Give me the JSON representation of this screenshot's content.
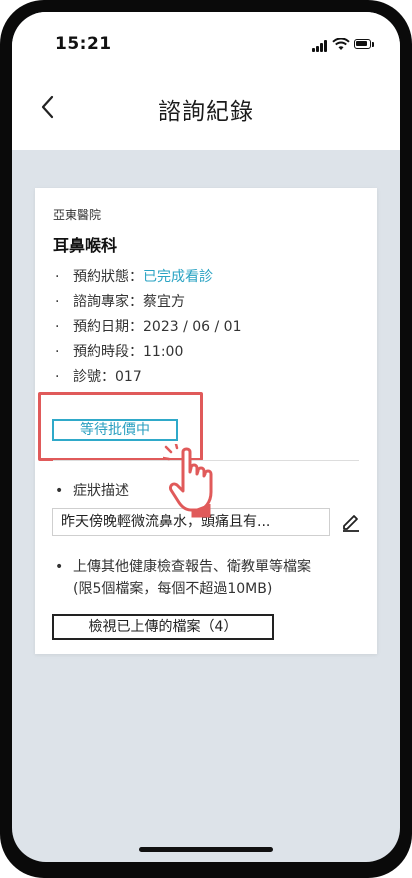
{
  "status_bar": {
    "time": "15:21"
  },
  "header": {
    "title": "諮詢紀錄"
  },
  "record": {
    "hospital": "亞東醫院",
    "department": "耳鼻喉科",
    "info": [
      {
        "label": "預約狀態：",
        "value": "已完成看診",
        "highlight": true
      },
      {
        "label": "諮詢專家：",
        "value": "蔡宜方"
      },
      {
        "label": "預約日期：",
        "value": "2023 / 06 / 01"
      },
      {
        "label": "預約時段：",
        "value": "11:00"
      },
      {
        "label": "診號：",
        "value": "017"
      }
    ],
    "status_button": "等待批價中",
    "symptom_label": "症狀描述",
    "symptom_text": "昨天傍晚輕微流鼻水，頭痛且有...",
    "upload_line1": "上傳其他健康檢查報告、衛教單等檔案",
    "upload_line2": "(限5個檔案，每個不超過10MB)",
    "view_files_button": "檢視已上傳的檔案（4）"
  },
  "colors": {
    "accent": "#2aa3c3",
    "highlight_box": "#e05a5a",
    "background": "#dde3e9"
  },
  "icons": [
    "back-chevron-icon",
    "signal-icon",
    "wifi-icon",
    "battery-icon",
    "edit-pencil-icon",
    "pointing-hand-icon"
  ]
}
